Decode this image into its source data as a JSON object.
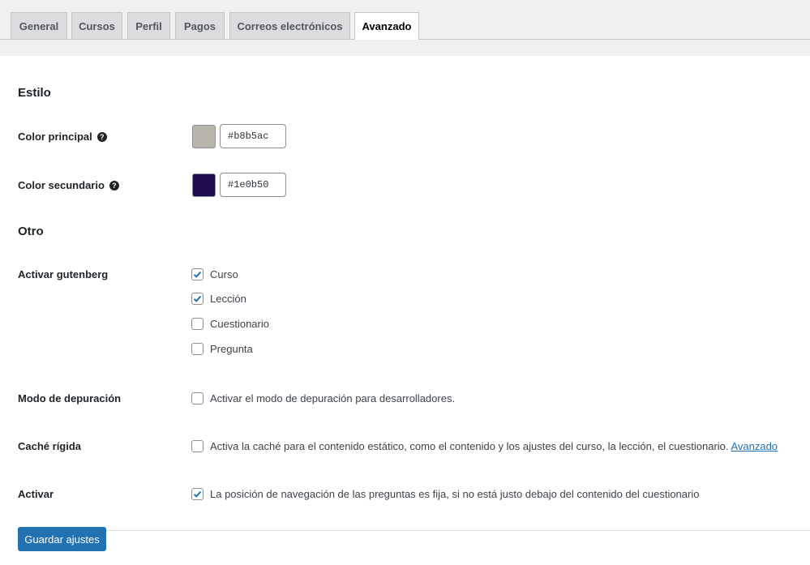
{
  "tabs": [
    {
      "label": "General"
    },
    {
      "label": "Cursos"
    },
    {
      "label": "Perfil"
    },
    {
      "label": "Pagos"
    },
    {
      "label": "Correos electrónicos"
    },
    {
      "label": "Avanzado",
      "active": true
    }
  ],
  "style_section": {
    "title": "Estilo",
    "primary_color": {
      "label": "Color principal",
      "value": "#b8b5ac",
      "swatch": "#b8b5ac"
    },
    "secondary_color": {
      "label": "Color secundario",
      "value": "#1e0b50",
      "swatch": "#1e0b50"
    },
    "help_icon": "question-circle-icon"
  },
  "other_section": {
    "title": "Otro",
    "gutenberg": {
      "label": "Activar gutenberg",
      "options": [
        {
          "label": "Curso",
          "checked": true
        },
        {
          "label": "Lección",
          "checked": true
        },
        {
          "label": "Cuestionario",
          "checked": false
        },
        {
          "label": "Pregunta",
          "checked": false
        }
      ]
    },
    "debug": {
      "label": "Modo de depuración",
      "option": "Activar el modo de depuración para desarrolladores.",
      "checked": false
    },
    "cache": {
      "label": "Caché rígida",
      "option": "Activa la caché para el contenido estático, como el contenido y los ajustes del curso, la lección, el cuestionario.",
      "link": "Avanzado",
      "checked": false
    },
    "activate": {
      "label": "Activar",
      "option": "La posición de navegación de las preguntas es fija, si no está justo debajo del contenido del cuestionario",
      "checked": true
    }
  },
  "save_button": "Guardar ajustes",
  "colors": {
    "accent": "#2271b1"
  }
}
